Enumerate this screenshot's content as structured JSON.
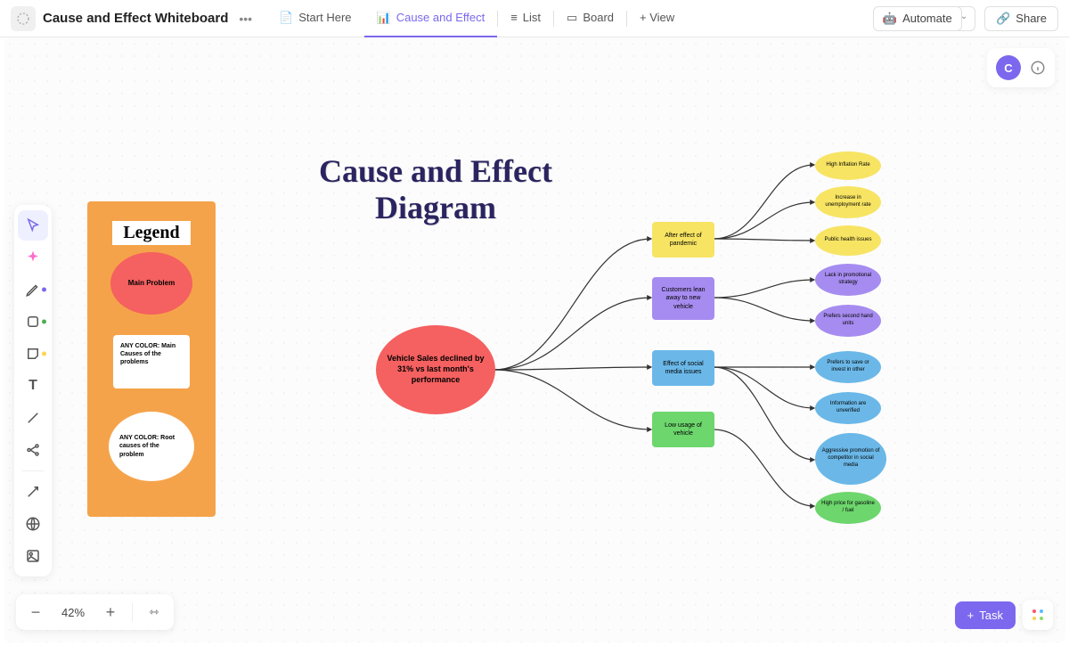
{
  "header": {
    "doc_title": "Cause and Effect Whiteboard",
    "tabs": [
      {
        "label": "Start Here",
        "icon": "📄"
      },
      {
        "label": "Cause and Effect",
        "icon": "📈"
      },
      {
        "label": "List",
        "icon": "≡"
      },
      {
        "label": "Board",
        "icon": "▭"
      },
      {
        "label": "+ View",
        "icon": ""
      }
    ],
    "automate": "Automate",
    "share": "Share"
  },
  "avatar": "C",
  "zoom": "42%",
  "task_button": "Task",
  "diagram": {
    "title": "Cause and Effect Diagram",
    "legend_title": "Legend",
    "legend_main": "Main Problem",
    "legend_causes": "ANY COLOR: Main Causes of the problems",
    "legend_root": "ANY COLOR: Root causes of the problem",
    "main_problem": "Vehicle Sales declined by 31% vs last month's performance",
    "causes": [
      "After effect of pandemic",
      "Customers lean away to new vehicle",
      "Effect of social media issues",
      "Low usage of vehicle"
    ],
    "root_causes": [
      "High Inflation Rate",
      "Increase in unemployment rate",
      "Public health issues",
      "Lack in promotional strategy",
      "Prefers second hand units",
      "Prefers to save or invest in other",
      "Information are unverified",
      "Aggressive promotion of competitor in social media",
      "High price for gasoline / fuel"
    ]
  },
  "colors": {
    "orange": "#f5a34a",
    "red": "#f56060",
    "yellow": "#f7e463",
    "purple": "#a68cf0",
    "blue": "#6bb8e8",
    "green": "#6dd66d",
    "brand": "#7b68ee"
  }
}
